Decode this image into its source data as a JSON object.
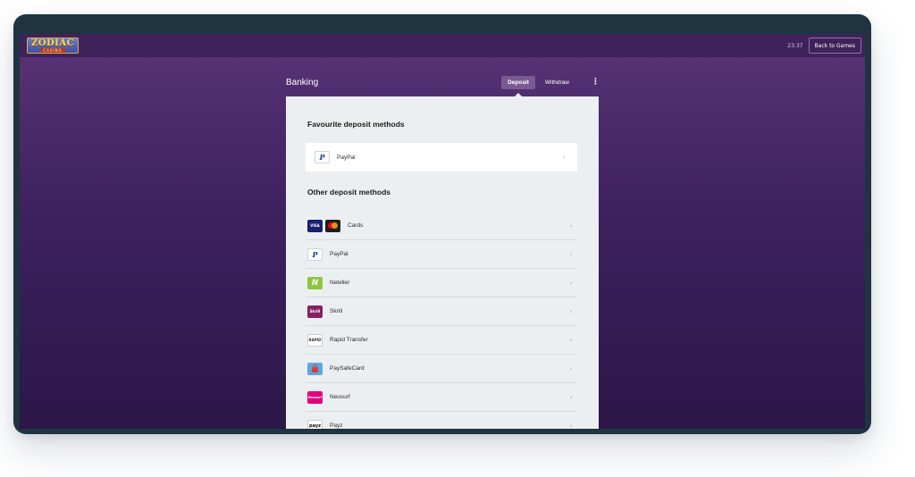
{
  "topbar": {
    "logo_main": "ZODIAC",
    "logo_sub": "CASINO",
    "clock": "23:37",
    "back_label": "Back to Games"
  },
  "banking": {
    "title": "Banking",
    "tabs": [
      {
        "label": "Deposit",
        "active": true
      },
      {
        "label": "Withdraw",
        "active": false
      }
    ],
    "menu_glyph": "⋮"
  },
  "favourites": {
    "title": "Favourite deposit methods",
    "items": [
      {
        "label": "PayPal",
        "icon": "paypal-icon"
      }
    ]
  },
  "other": {
    "title": "Other deposit methods",
    "items": [
      {
        "label": "Cards",
        "icon": "cards-icon",
        "icon_text": "VISA"
      },
      {
        "label": "PayPal",
        "icon": "paypal-icon",
        "icon_text": "P"
      },
      {
        "label": "Neteller",
        "icon": "neteller-icon",
        "icon_text": "N"
      },
      {
        "label": "Skrill",
        "icon": "skrill-icon",
        "icon_text": "Skrill"
      },
      {
        "label": "Rapid Transfer",
        "icon": "rapid-transfer-icon",
        "icon_text": "RAPID"
      },
      {
        "label": "PaySafeCard",
        "icon": "paysafecard-icon"
      },
      {
        "label": "Neosurf",
        "icon": "neosurf-icon",
        "icon_text": "Neosurf"
      },
      {
        "label": "Payz",
        "icon": "payz-icon",
        "icon_text": "payz"
      }
    ]
  },
  "chevron": "›",
  "colors": {
    "accent": "#7a5a92",
    "background_top": "#5a3478",
    "background_bottom": "#2c1748",
    "panel": "#eceff1"
  }
}
